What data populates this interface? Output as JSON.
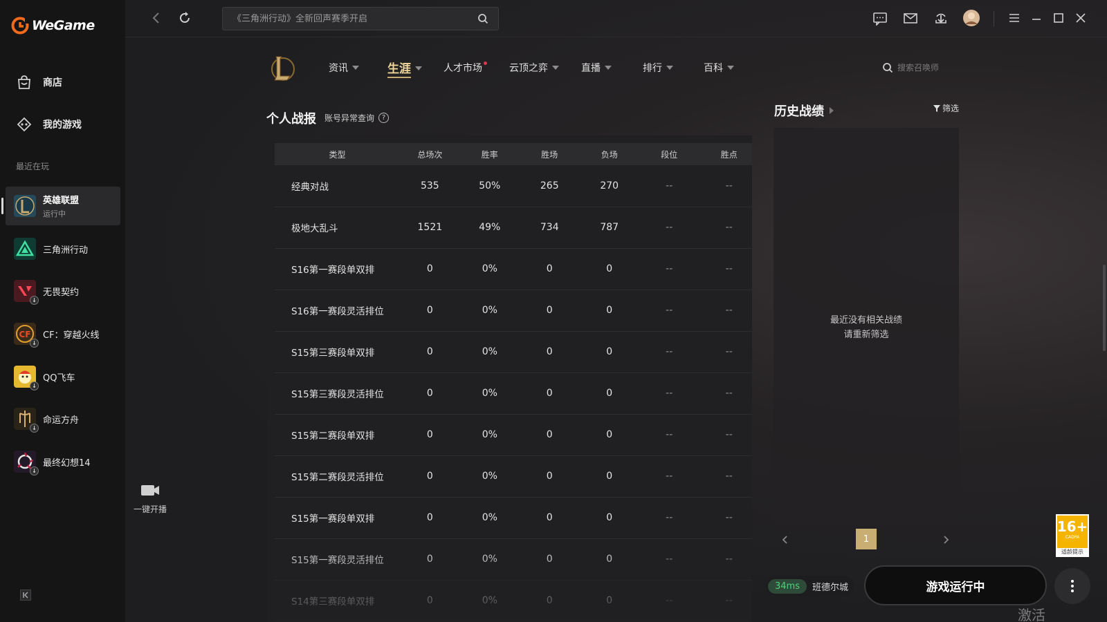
{
  "app": {
    "logo_text": "WeGame"
  },
  "sidebar": {
    "nav": [
      {
        "label": "商店",
        "icon": "shop-bag-icon"
      },
      {
        "label": "我的游戏",
        "icon": "gamepad-icon"
      }
    ],
    "recent_label": "最近在玩",
    "games": [
      {
        "name": "英雄联盟",
        "status": "运行中",
        "active": true,
        "icon": "league-of-legends-icon",
        "color": "#2a5a6a"
      },
      {
        "name": "三角洲行动",
        "status": "",
        "active": false,
        "icon": "delta-force-icon",
        "color": "#0f3b33"
      },
      {
        "name": "无畏契约",
        "status": "",
        "active": false,
        "icon": "valorant-icon",
        "color": "#5a1c24"
      },
      {
        "name": "CF：穿越火线",
        "status": "",
        "active": false,
        "icon": "crossfire-icon",
        "color": "#3a2a1a"
      },
      {
        "name": "QQ飞车",
        "status": "",
        "active": false,
        "icon": "qq-speed-icon",
        "color": "#5a4a10"
      },
      {
        "name": "命运方舟",
        "status": "",
        "active": false,
        "icon": "lost-ark-icon",
        "color": "#3a3020"
      },
      {
        "name": "最终幻想14",
        "status": "",
        "active": false,
        "icon": "final-fantasy-14-icon",
        "color": "#2a2030"
      }
    ]
  },
  "topbar": {
    "search_placeholder": "《三角洲行动》全新回声赛季开启"
  },
  "game_nav": {
    "items": [
      {
        "label": "资讯",
        "caret": true,
        "dot": false,
        "active": false
      },
      {
        "label": "生涯",
        "caret": true,
        "dot": false,
        "active": true
      },
      {
        "label": "人才市场",
        "caret": false,
        "dot": true,
        "active": false
      },
      {
        "label": "云顶之弈",
        "caret": true,
        "dot": false,
        "active": false
      },
      {
        "label": "直播",
        "caret": true,
        "dot": false,
        "active": false
      },
      {
        "label": "排行",
        "caret": true,
        "dot": false,
        "active": false
      },
      {
        "label": "百科",
        "caret": true,
        "dot": false,
        "active": false
      }
    ],
    "search_placeholder": "搜索召唤师"
  },
  "stats": {
    "title": "个人战报",
    "subtitle": "账号异常查询",
    "help": "?",
    "columns": [
      "类型",
      "总场次",
      "胜率",
      "胜场",
      "负场",
      "段位",
      "胜点"
    ],
    "rows": [
      [
        "经典对战",
        "535",
        "50%",
        "265",
        "270",
        "--",
        "--"
      ],
      [
        "极地大乱斗",
        "1521",
        "49%",
        "734",
        "787",
        "--",
        "--"
      ],
      [
        "S16第一赛段单双排",
        "0",
        "0%",
        "0",
        "0",
        "--",
        "--"
      ],
      [
        "S16第一赛段灵活排位",
        "0",
        "0%",
        "0",
        "0",
        "--",
        "--"
      ],
      [
        "S15第三赛段单双排",
        "0",
        "0%",
        "0",
        "0",
        "--",
        "--"
      ],
      [
        "S15第三赛段灵活排位",
        "0",
        "0%",
        "0",
        "0",
        "--",
        "--"
      ],
      [
        "S15第二赛段单双排",
        "0",
        "0%",
        "0",
        "0",
        "--",
        "--"
      ],
      [
        "S15第二赛段灵活排位",
        "0",
        "0%",
        "0",
        "0",
        "--",
        "--"
      ],
      [
        "S15第一赛段单双排",
        "0",
        "0%",
        "0",
        "0",
        "--",
        "--"
      ],
      [
        "S15第一赛段灵活排位",
        "0",
        "0%",
        "0",
        "0",
        "--",
        "--"
      ],
      [
        "S14第三赛段单双排",
        "0",
        "0%",
        "0",
        "0",
        "--",
        "--"
      ]
    ]
  },
  "history": {
    "title": "历史战绩",
    "filter_label": "筛选",
    "empty_line1": "最近没有相关战绩",
    "empty_line2": "请重新筛选",
    "page": "1"
  },
  "bottom": {
    "live_label": "一键开播",
    "ping": "34ms",
    "server": "班德尔城",
    "run_label": "游戏运行中",
    "age_num": "16+",
    "age_sub": "CADPA",
    "age_foot": "适龄提示",
    "watermark": "激活 Windows"
  },
  "colors": {
    "accent_gold": "#c9aa71",
    "ping_green": "#4fd27a",
    "age_yellow": "#f5b400"
  }
}
